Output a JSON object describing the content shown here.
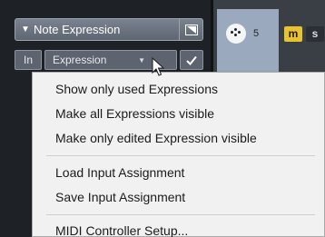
{
  "inspector": {
    "section_title": "Note Expression",
    "in_label": "In",
    "expression_label": "Expression"
  },
  "track": {
    "number": "5",
    "mute_label": "m",
    "solo_label": "s"
  },
  "context_menu": {
    "items": [
      "Show only used Expressions",
      "Make all Expressions visible",
      "Make only edited Expression visible",
      "Load Input Assignment",
      "Save Input Assignment",
      "MIDI Controller Setup..."
    ]
  },
  "colors": {
    "mute_active": "#e9c230",
    "menu_background": "#f1f1f1",
    "track_highlight": "#9aa9bd"
  },
  "icons": [
    "expand-triangle-icon",
    "panel-toggle-icon",
    "checkmark-icon",
    "dropdown-arrow-icon",
    "midi-port-icon",
    "mouse-cursor-icon"
  ]
}
